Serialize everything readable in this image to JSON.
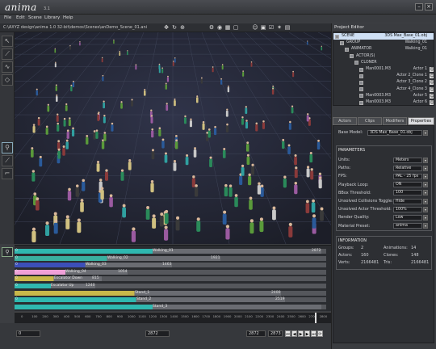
{
  "app": {
    "logo": "anima",
    "version": "3.1"
  },
  "menu": [
    "File",
    "Edit",
    "Scene",
    "Library",
    "Help"
  ],
  "path": "C:\\AXYZ design\\anima 1.0 32-bit\\demos\\Scenes\\anDemo_Scene_01.ani",
  "timeline": {
    "rows": [
      {
        "label": "Walking_01",
        "start": "0",
        "end": "2872",
        "color": "#2fb8b0",
        "left": 0,
        "width": 380
      },
      {
        "label": "Walking_02",
        "start": "0",
        "end": "1921",
        "color": "#3aaf9f",
        "left": 0,
        "width": 255
      },
      {
        "label": "Walking_03",
        "start": "0",
        "end": "1463",
        "color": "#3c4fb8",
        "left": 0,
        "width": 195
      },
      {
        "label": "Walking_04",
        "start": "0",
        "end": "1054",
        "color": "#f0a0d8",
        "left": 0,
        "width": 140
      },
      {
        "label": "Escalator Down",
        "start": "0",
        "end": "815",
        "color": "#c8b84a",
        "left": 0,
        "width": 108
      },
      {
        "label": "Escalator Up",
        "start": "0",
        "end": "1240",
        "color": "#2fb8b0",
        "left": 0,
        "width": 100
      },
      {
        "label": "Stand_1",
        "start": "",
        "end": "2400",
        "color": "#c8b84a",
        "left": 0,
        "width": 330
      },
      {
        "label": "Stand_2",
        "start": "0",
        "end": "2519",
        "color": "#2fb8b0",
        "left": 0,
        "width": 335
      },
      {
        "label": "Stand_3",
        "start": "",
        "end": "",
        "color": "#2fb8b0",
        "left": 0,
        "width": 380
      }
    ],
    "ticks": [
      "0",
      "100",
      "200",
      "300",
      "400",
      "500",
      "600",
      "700",
      "800",
      "900",
      "1000",
      "1100",
      "1200",
      "1300",
      "1400",
      "1500",
      "1600",
      "1700",
      "1800",
      "1900",
      "2000",
      "2100",
      "2200",
      "2300",
      "2400",
      "2500",
      "2600",
      "2700",
      "2800"
    ],
    "frame_start": "0",
    "frame_current": "2872",
    "frame_end": "2872",
    "frame_end2": "2873"
  },
  "project": {
    "title": "Project Editor",
    "tree": [
      {
        "name": "SCENE",
        "value": "3DS Max_Base_01.obj",
        "indent": 2,
        "selected": true
      },
      {
        "name": "GROUP",
        "value": "Walking_01",
        "indent": 8,
        "selected": false
      },
      {
        "name": "ANIMATOR",
        "value": "Walking_01",
        "indent": 14,
        "selected": false
      },
      {
        "name": "ACTOR(S)",
        "value": "",
        "indent": 20,
        "selected": false
      },
      {
        "name": "CLONER",
        "value": "",
        "indent": 26,
        "selected": false
      },
      {
        "name": "Man0001.M3",
        "value": "Actor 1",
        "indent": 32,
        "selected": false
      },
      {
        "name": "",
        "value": "Actor 2_Clone 1",
        "indent": 32,
        "selected": false
      },
      {
        "name": "",
        "value": "Actor 3_Clone 2",
        "indent": 32,
        "selected": false
      },
      {
        "name": "",
        "value": "Actor 4_Clone 3",
        "indent": 32,
        "selected": false
      },
      {
        "name": "Man0003.M3",
        "value": "Actor 5",
        "indent": 32,
        "selected": false
      },
      {
        "name": "Man0003.M3",
        "value": "Actor 6",
        "indent": 32,
        "selected": false
      }
    ]
  },
  "tabs": [
    "Actors",
    "Clips",
    "Modifiers",
    "Properties"
  ],
  "properties": {
    "base_model_label": "Base Model:",
    "base_model_value": "3DS Max_Base_01.obj",
    "parameters_title": "PARAMETERS",
    "params": [
      {
        "label": "Units:",
        "value": "Meters"
      },
      {
        "label": "Paths:",
        "value": "Relative"
      },
      {
        "label": "FPS:",
        "value": "PAL - 25 fps"
      },
      {
        "label": "Playback Loop:",
        "value": "ON"
      },
      {
        "label": "BBox Threshold:",
        "value": "100"
      },
      {
        "label": "Unsolved Collisions Toggle:",
        "value": "Hide"
      },
      {
        "label": "Unsolved Actor Threshold:",
        "value": "100%"
      },
      {
        "label": "Render Quality:",
        "value": "Low"
      },
      {
        "label": "Material Preset:",
        "value": "anima"
      }
    ],
    "information_title": "INFORMATION",
    "info": [
      {
        "label": "Groups:",
        "value": "2",
        "label2": "Animations:",
        "value2": "14"
      },
      {
        "label": "Actors:",
        "value": "160",
        "label2": "Clones:",
        "value2": "148"
      },
      {
        "label": "Verts:",
        "value": "2166481",
        "label2": "Tris:",
        "value2": "2166481"
      }
    ]
  }
}
